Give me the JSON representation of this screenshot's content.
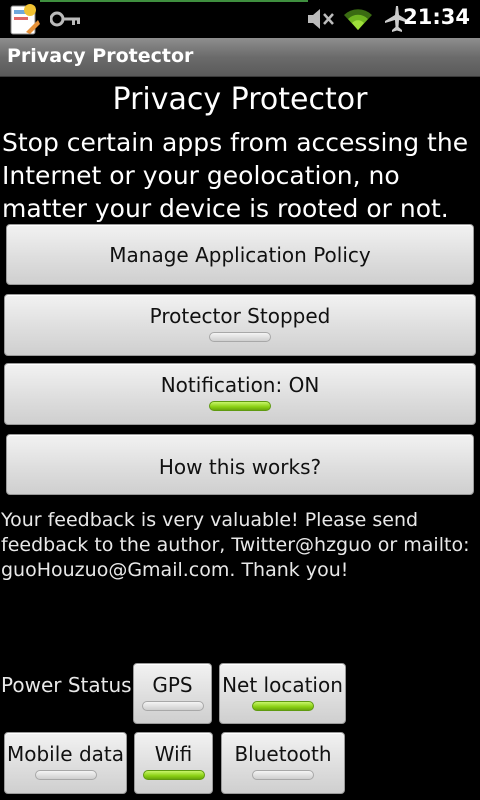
{
  "status_bar": {
    "time": "21:34",
    "icons": [
      "app-notification-icon",
      "key-icon",
      "mute-icon",
      "wifi-icon",
      "airplane-icon"
    ]
  },
  "title_bar": {
    "title": "Privacy Protector"
  },
  "main": {
    "heading": "Privacy Protector",
    "description": "Stop certain apps from accessing the Internet or your geolocation, no matter your device is rooted or not.",
    "buttons": {
      "manage_label": "Manage Application Policy",
      "protector_label": "Protector Stopped",
      "protector_on": false,
      "notification_label": "Notification: ON",
      "notification_on": true,
      "how_label": "How this works?"
    },
    "feedback": "Your feedback is very valuable! Please send feedback to the author, Twitter@hzguo or mailto: guoHouzuo@Gmail.com. Thank you!"
  },
  "power": {
    "label": "Power Status",
    "toggles": [
      {
        "label": "GPS",
        "on": false
      },
      {
        "label": "Net location",
        "on": true
      },
      {
        "label": "Mobile data",
        "on": false
      },
      {
        "label": "Wifi",
        "on": true
      },
      {
        "label": "Bluetooth",
        "on": false
      }
    ]
  },
  "colors": {
    "indicator_on": "#8ad014",
    "indicator_off": "#e0e0e0",
    "background": "#000000"
  }
}
